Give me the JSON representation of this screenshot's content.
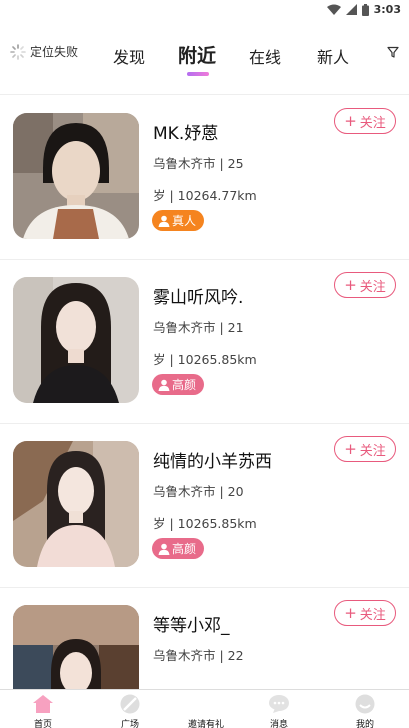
{
  "status_bar": {
    "time": "3:03"
  },
  "header": {
    "location_label": "定位失败",
    "tabs": [
      {
        "label": "发现",
        "active": false
      },
      {
        "label": "附近",
        "active": true
      },
      {
        "label": "在线",
        "active": false
      },
      {
        "label": "新人",
        "active": false
      }
    ]
  },
  "users": [
    {
      "name": "MK.妤蒽",
      "info_line1": "乌鲁木齐市 | 25",
      "info_line2": "岁 | 10264.77km",
      "badge": "真人",
      "badge_color": "#f5841f",
      "follow_label": "关注"
    },
    {
      "name": "雾山听风吟.",
      "info_line1": "乌鲁木齐市 | 21",
      "info_line2": "岁 | 10265.85km",
      "badge": "高颜",
      "badge_color": "#e86b8a",
      "follow_label": "关注"
    },
    {
      "name": "纯情的小羊苏西",
      "info_line1": "乌鲁木齐市 | 20",
      "info_line2": "岁 | 10265.85km",
      "badge": "高颜",
      "badge_color": "#e86b8a",
      "follow_label": "关注"
    },
    {
      "name": "等等小邓_",
      "info_line1": "乌鲁木齐市 | 22",
      "follow_label": "关注"
    }
  ],
  "bottom_nav": [
    {
      "label": "首页",
      "icon": "home-icon",
      "active": true
    },
    {
      "label": "广场",
      "icon": "plaza-icon",
      "active": false
    },
    {
      "label": "邀请有礼",
      "icon": "gift-icon",
      "active": false
    },
    {
      "label": "消息",
      "icon": "message-icon",
      "active": false
    },
    {
      "label": "我的",
      "icon": "profile-icon",
      "active": false
    }
  ],
  "colors": {
    "accent": "#e85a7d",
    "tab_underline": "#c96fe6",
    "badge_real": "#f5841f",
    "badge_beauty": "#e86b8a",
    "home_active": "#f7a1c0"
  }
}
